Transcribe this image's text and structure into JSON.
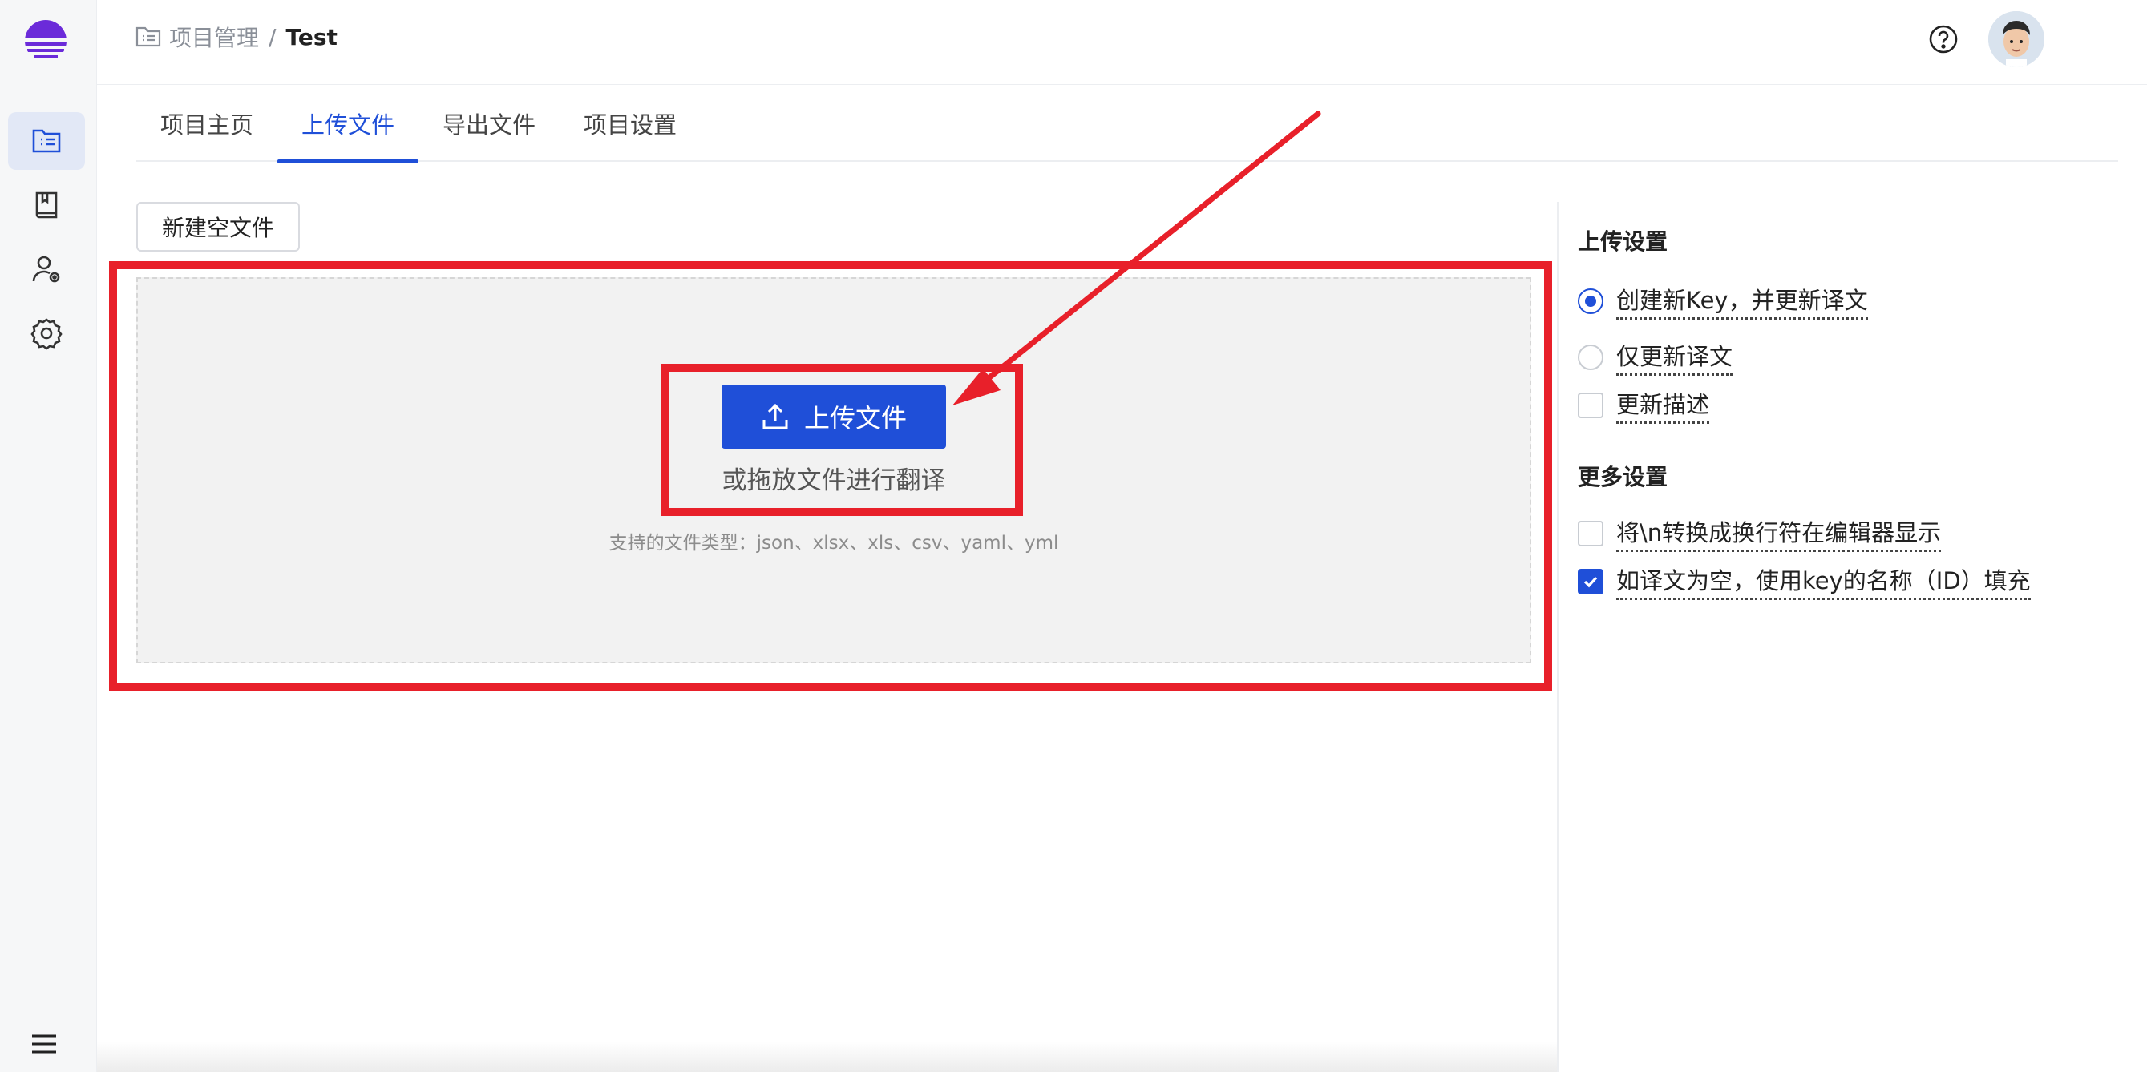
{
  "breadcrumb": {
    "parent": "项目管理",
    "separator": "/",
    "current": "Test"
  },
  "sidebar": {
    "items": [
      {
        "name": "projects",
        "icon": "file-list-icon",
        "active": true
      },
      {
        "name": "glossary",
        "icon": "book-icon",
        "active": false
      },
      {
        "name": "members",
        "icon": "user-settings-icon",
        "active": false
      },
      {
        "name": "settings",
        "icon": "gear-icon",
        "active": false
      }
    ],
    "menu_icon": "hamburger-icon"
  },
  "tabs": [
    {
      "label": "项目主页",
      "active": false
    },
    {
      "label": "上传文件",
      "active": true
    },
    {
      "label": "导出文件",
      "active": false
    },
    {
      "label": "项目设置",
      "active": false
    }
  ],
  "main": {
    "new_file_label": "新建空文件",
    "upload_label": "上传文件",
    "drop_text": "或拖放文件进行翻译",
    "supported_types": "支持的文件类型：json、xlsx、xls、csv、yaml、yml"
  },
  "upload_settings": {
    "title": "上传设置",
    "options": [
      {
        "type": "radio",
        "label": "创建新Key，并更新译文",
        "checked": true
      },
      {
        "type": "radio",
        "label": "仅更新译文",
        "checked": false
      },
      {
        "type": "checkbox",
        "label": "更新描述",
        "checked": false
      }
    ]
  },
  "more_settings": {
    "title": "更多设置",
    "options": [
      {
        "type": "checkbox",
        "label": "将\\n转换成换行符在编辑器显示",
        "checked": false
      },
      {
        "type": "checkbox",
        "label": "如译文为空，使用key的名称（ID）填充",
        "checked": true
      }
    ]
  },
  "colors": {
    "primary": "#1f4fd8",
    "annotation": "#e8202a",
    "logo": "#6b2bd9"
  }
}
